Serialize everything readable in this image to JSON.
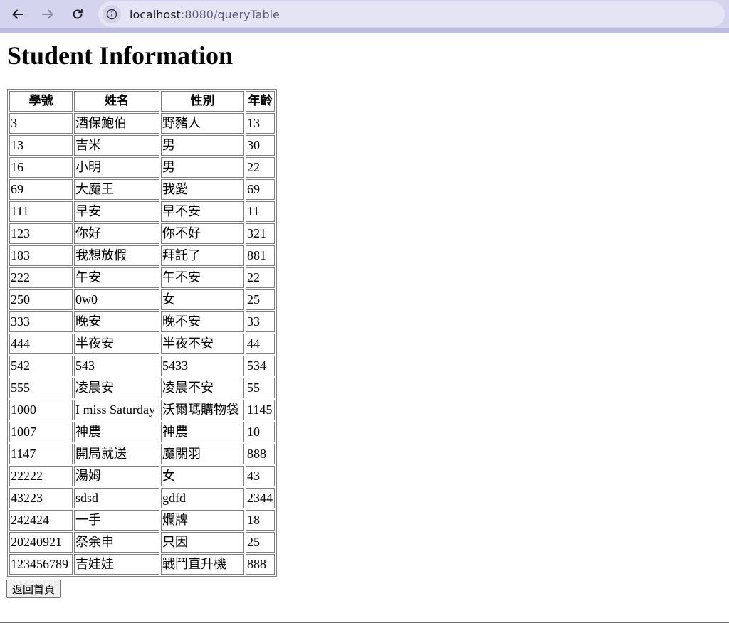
{
  "browser": {
    "url_host": "localhost",
    "url_rest": ":8080/queryTable"
  },
  "page": {
    "title": "Student Information",
    "home_button_label": "返回首頁"
  },
  "table": {
    "headers": [
      "學號",
      "姓名",
      "性別",
      "年齡"
    ],
    "rows": [
      [
        "3",
        "酒保鮑伯",
        "野豬人",
        "13"
      ],
      [
        "13",
        "吉米",
        "男",
        "30"
      ],
      [
        "16",
        "小明",
        "男",
        "22"
      ],
      [
        "69",
        "大魔王",
        "我愛",
        "69"
      ],
      [
        "111",
        "早安",
        "早不安",
        "11"
      ],
      [
        "123",
        "你好",
        "你不好",
        "321"
      ],
      [
        "183",
        "我想放假",
        "拜託了",
        "881"
      ],
      [
        "222",
        "午安",
        "午不安",
        "22"
      ],
      [
        "250",
        "0w0",
        "女",
        "25"
      ],
      [
        "333",
        "晚安",
        "晚不安",
        "33"
      ],
      [
        "444",
        "半夜安",
        "半夜不安",
        "44"
      ],
      [
        "542",
        "543",
        "5433",
        "534"
      ],
      [
        "555",
        "凌晨安",
        "凌晨不安",
        "55"
      ],
      [
        "1000",
        "I miss Saturday",
        "沃爾瑪購物袋",
        "1145"
      ],
      [
        "1007",
        "神農",
        "神農",
        "10"
      ],
      [
        "1147",
        "開局就送",
        "魔關羽",
        "888"
      ],
      [
        "22222",
        "湯姆",
        "女",
        "43"
      ],
      [
        "43223",
        "sdsd",
        "gdfd",
        "2344"
      ],
      [
        "242424",
        "一手",
        "爛牌",
        "18"
      ],
      [
        "20240921",
        "祭余申",
        "只因",
        "25"
      ],
      [
        "123456789",
        "吉娃娃",
        "戰鬥直升機",
        "888"
      ]
    ]
  }
}
